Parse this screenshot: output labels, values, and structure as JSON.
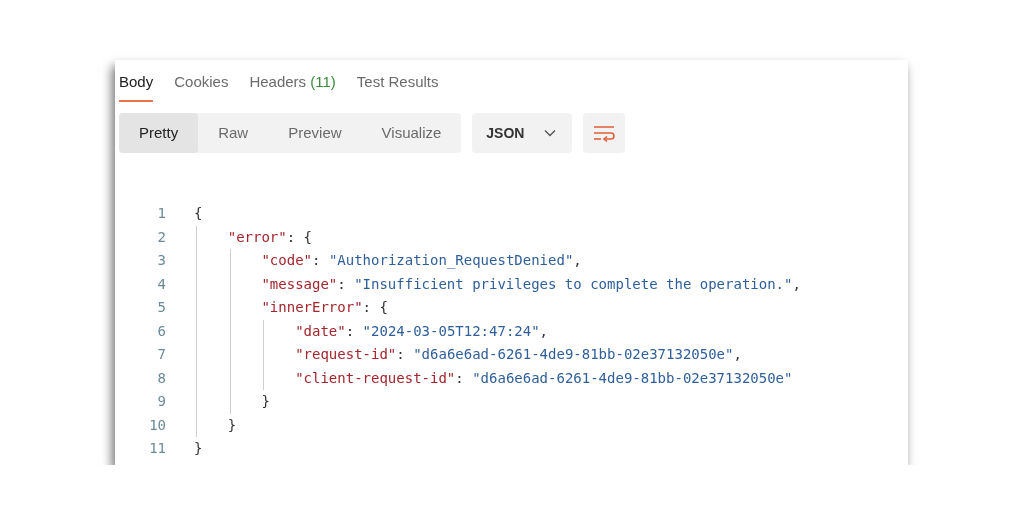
{
  "tabs": [
    {
      "label": "Body",
      "selected": true
    },
    {
      "label": "Cookies",
      "selected": false
    },
    {
      "label": "Headers",
      "count": "(11)",
      "selected": false
    },
    {
      "label": "Test Results",
      "selected": false
    }
  ],
  "view_modes": [
    {
      "label": "Pretty",
      "selected": true
    },
    {
      "label": "Raw",
      "selected": false
    },
    {
      "label": "Preview",
      "selected": false
    },
    {
      "label": "Visualize",
      "selected": false
    }
  ],
  "format_dropdown": {
    "value": "JSON"
  },
  "code": [
    {
      "number": "1",
      "tokens": [
        {
          "kind": "punct",
          "text": "{"
        }
      ],
      "children": [
        {
          "number": "2",
          "tokens": [
            {
              "kind": "key",
              "text": "\"error\""
            },
            {
              "kind": "punct",
              "text": ": {"
            }
          ],
          "children": [
            {
              "number": "3",
              "tokens": [
                {
                  "kind": "key",
                  "text": "\"code\""
                },
                {
                  "kind": "punct",
                  "text": ": "
                },
                {
                  "kind": "string",
                  "text": "\"Authorization_RequestDenied\""
                },
                {
                  "kind": "punct",
                  "text": ","
                }
              ]
            },
            {
              "number": "4",
              "tokens": [
                {
                  "kind": "key",
                  "text": "\"message\""
                },
                {
                  "kind": "punct",
                  "text": ": "
                },
                {
                  "kind": "string",
                  "text": "\"Insufficient privileges to complete the operation.\""
                },
                {
                  "kind": "punct",
                  "text": ","
                }
              ]
            },
            {
              "number": "5",
              "tokens": [
                {
                  "kind": "key",
                  "text": "\"innerError\""
                },
                {
                  "kind": "punct",
                  "text": ": {"
                }
              ],
              "children": [
                {
                  "number": "6",
                  "tokens": [
                    {
                      "kind": "key",
                      "text": "\"date\""
                    },
                    {
                      "kind": "punct",
                      "text": ": "
                    },
                    {
                      "kind": "string",
                      "text": "\"2024-03-05T12:47:24\""
                    },
                    {
                      "kind": "punct",
                      "text": ","
                    }
                  ]
                },
                {
                  "number": "7",
                  "tokens": [
                    {
                      "kind": "key",
                      "text": "\"request-id\""
                    },
                    {
                      "kind": "punct",
                      "text": ": "
                    },
                    {
                      "kind": "string",
                      "text": "\"d6a6e6ad-6261-4de9-81bb-02e37132050e\""
                    },
                    {
                      "kind": "punct",
                      "text": ","
                    }
                  ]
                },
                {
                  "number": "8",
                  "tokens": [
                    {
                      "kind": "key",
                      "text": "\"client-request-id\""
                    },
                    {
                      "kind": "punct",
                      "text": ": "
                    },
                    {
                      "kind": "string",
                      "text": "\"d6a6e6ad-6261-4de9-81bb-02e37132050e\""
                    }
                  ]
                }
              ]
            },
            {
              "number": "9",
              "tokens": [
                {
                  "kind": "punct",
                  "text": "}"
                }
              ]
            }
          ]
        },
        {
          "number": "10",
          "tokens": [
            {
              "kind": "punct",
              "text": "}"
            }
          ]
        }
      ]
    },
    {
      "number": "11",
      "tokens": [
        {
          "kind": "punct",
          "text": "}"
        }
      ]
    }
  ]
}
